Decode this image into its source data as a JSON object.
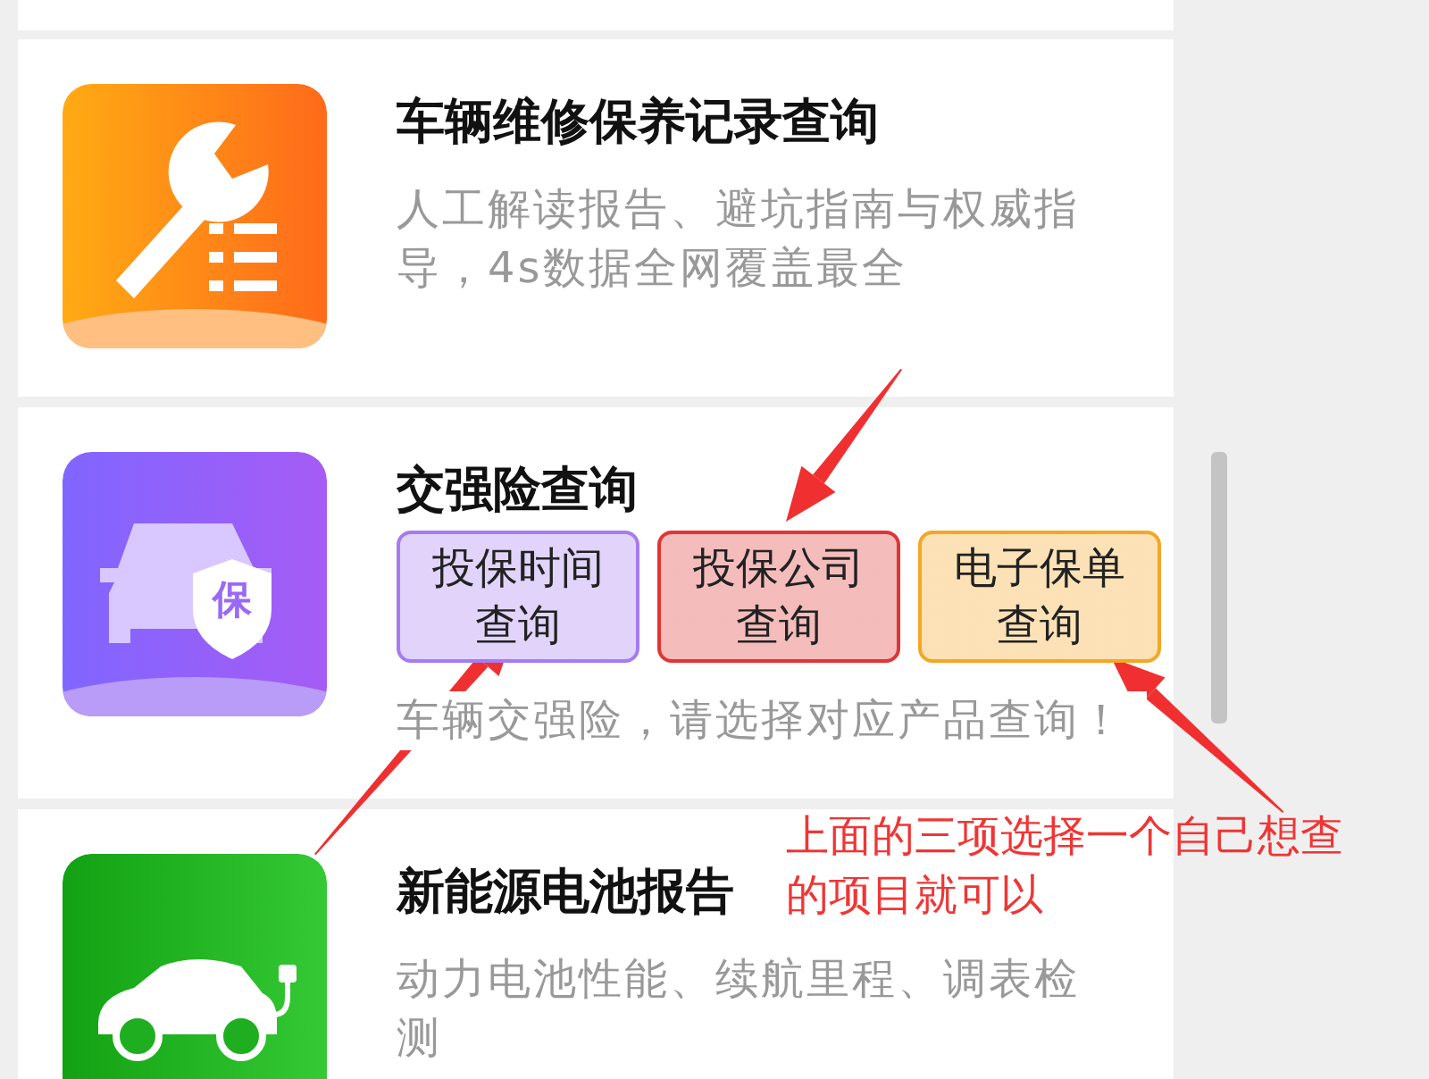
{
  "cards": [
    {
      "title": "车辆维修保养记录查询",
      "description": "人工解读报告、避坑指南与权威指导，4s数据全网覆盖最全"
    },
    {
      "title": "交强险查询",
      "icon_text": "保",
      "options": [
        {
          "label": "投保时间查询",
          "color": "#a57cf0"
        },
        {
          "label": "投保公司查询",
          "color": "#e03535"
        },
        {
          "label": "电子保单查询",
          "color": "#f5a623"
        }
      ],
      "description": "车辆交强险，请选择对应产品查询！"
    },
    {
      "title": "新能源电池报告",
      "description": "动力电池性能、续航里程、调表检测"
    }
  ],
  "annotation": {
    "note": "上面的三项选择一个自己想查的项目就可以"
  }
}
